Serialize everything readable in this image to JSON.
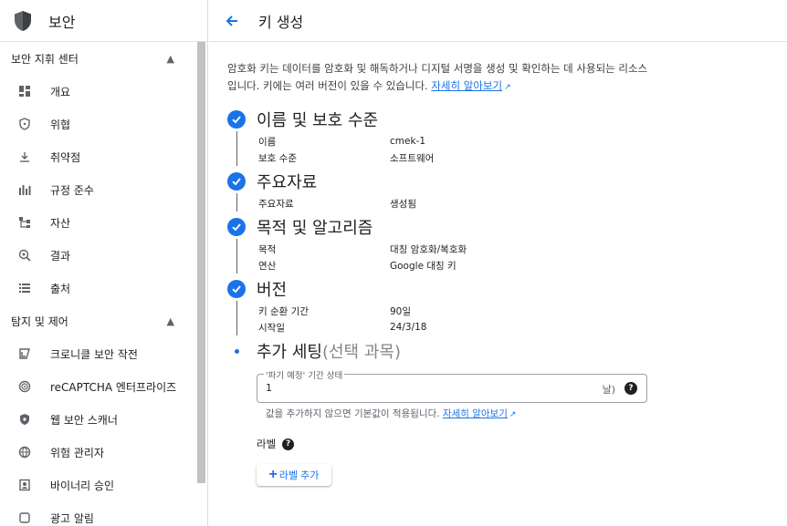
{
  "sidebar": {
    "title": "보안",
    "sections": [
      {
        "label": "보안 지휘 센터",
        "items": [
          {
            "label": "개요",
            "icon": "dashboard-icon"
          },
          {
            "label": "위협",
            "icon": "shield-icon"
          },
          {
            "label": "취약점",
            "icon": "download-icon"
          },
          {
            "label": "규정 준수",
            "icon": "bar-chart-icon"
          },
          {
            "label": "자산",
            "icon": "hierarchy-icon"
          },
          {
            "label": "결과",
            "icon": "search-icon"
          },
          {
            "label": "출처",
            "icon": "list-icon"
          }
        ]
      },
      {
        "label": "탐지 및 제어",
        "items": [
          {
            "label": "크로니클 보안 작전",
            "icon": "chronicle-icon"
          },
          {
            "label": "reCAPTCHA 엔터프라이즈",
            "icon": "recaptcha-icon"
          },
          {
            "label": "웹 보안 스캐너",
            "icon": "shield-filled-icon"
          },
          {
            "label": "위험 관리자",
            "icon": "globe-icon"
          },
          {
            "label": "바이너리 승인",
            "icon": "badge-icon"
          },
          {
            "label": "광고 알림",
            "icon": "alert-icon"
          }
        ]
      }
    ]
  },
  "header": {
    "back_icon": "arrow-back-icon",
    "title": "키 생성"
  },
  "description": {
    "text": "암호화 키는 데이터를 암호화 및 해독하거나 디지털 서명을 생성 및 확인하는 데 사용되는 리소스입니다. 키에는 여러 버전이 있을 수 있습니다.",
    "link": "자세히 알아보기"
  },
  "steps": [
    {
      "title": "이름 및 보호 수준",
      "rows": [
        {
          "key": "이름",
          "value": "cmek-1"
        },
        {
          "key": "보호 수준",
          "value": "소프트웨어"
        }
      ]
    },
    {
      "title": "주요자료",
      "rows": [
        {
          "key": "주요자료",
          "value": "생성됨"
        }
      ]
    },
    {
      "title": "목적 및 알고리즘",
      "rows": [
        {
          "key": "목적",
          "value": "대칭 암호화/복호화"
        },
        {
          "key": "연산",
          "value": "Google 대칭 키"
        }
      ]
    },
    {
      "title": "버전",
      "rows": [
        {
          "key": "키 순환 기간",
          "value": "90일"
        },
        {
          "key": "시작일",
          "value": "24/3/18"
        }
      ]
    }
  ],
  "additional": {
    "title": "추가 세팅",
    "optional": "(선택 과목)",
    "field_label": "'파기 예정' 기간 상태",
    "field_value": "1",
    "field_suffix": "날)",
    "hint": "값을 추가하지 않으면 기본값이 적용됩니다.",
    "hint_link": "자세히 알아보기",
    "labels_title": "라벨",
    "add_label_button": "라벨 추가"
  },
  "colors": {
    "accent": "#1a73e8",
    "text": "#202124",
    "muted": "#5f6368"
  }
}
